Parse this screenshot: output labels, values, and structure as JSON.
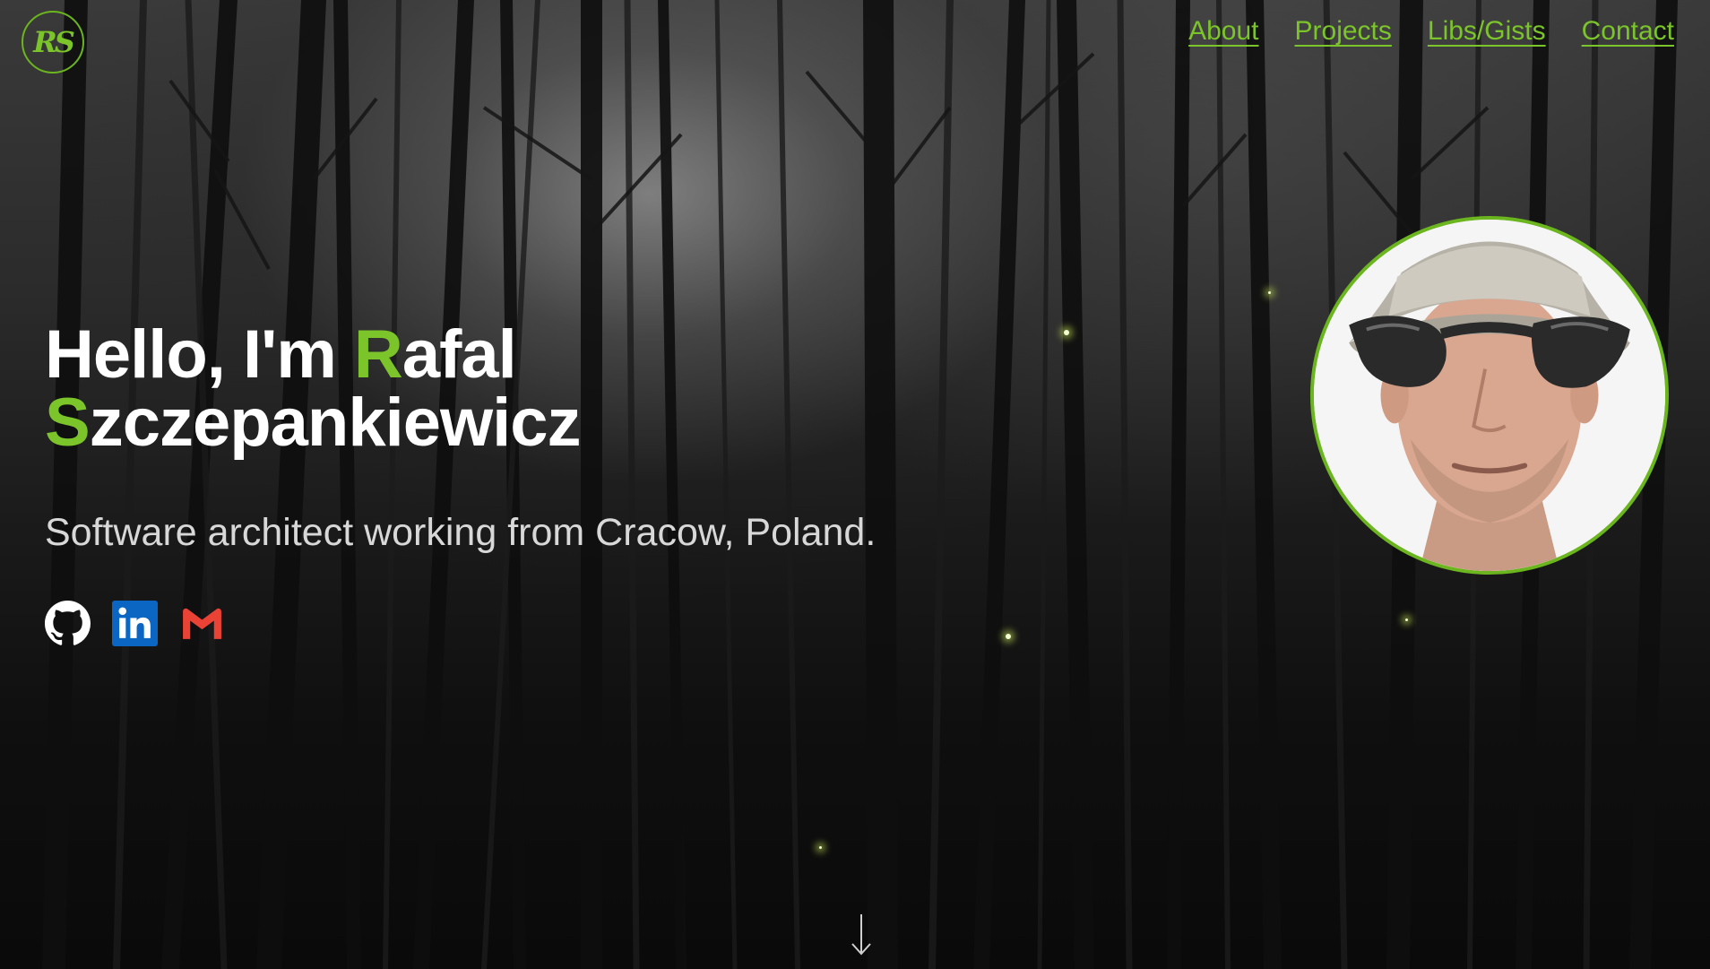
{
  "logo": {
    "text": "RS"
  },
  "nav": {
    "about": "About",
    "projects": "Projects",
    "libs": "Libs/Gists",
    "contact": "Contact"
  },
  "hero": {
    "line1_prefix": "Hello, I'm ",
    "first_initial": "R",
    "first_rest": "afal",
    "last_initial": "S",
    "last_rest": "zczepankiewicz",
    "subtitle": "Software architect working from Cracow, Poland."
  },
  "socials": [
    {
      "icon": "github-icon"
    },
    {
      "icon": "linkedin-icon"
    },
    {
      "icon": "gmail-icon"
    }
  ],
  "colors": {
    "accent": "#7bc42a",
    "linkedin": "#0a66c2",
    "gmail": "#ea4335"
  }
}
